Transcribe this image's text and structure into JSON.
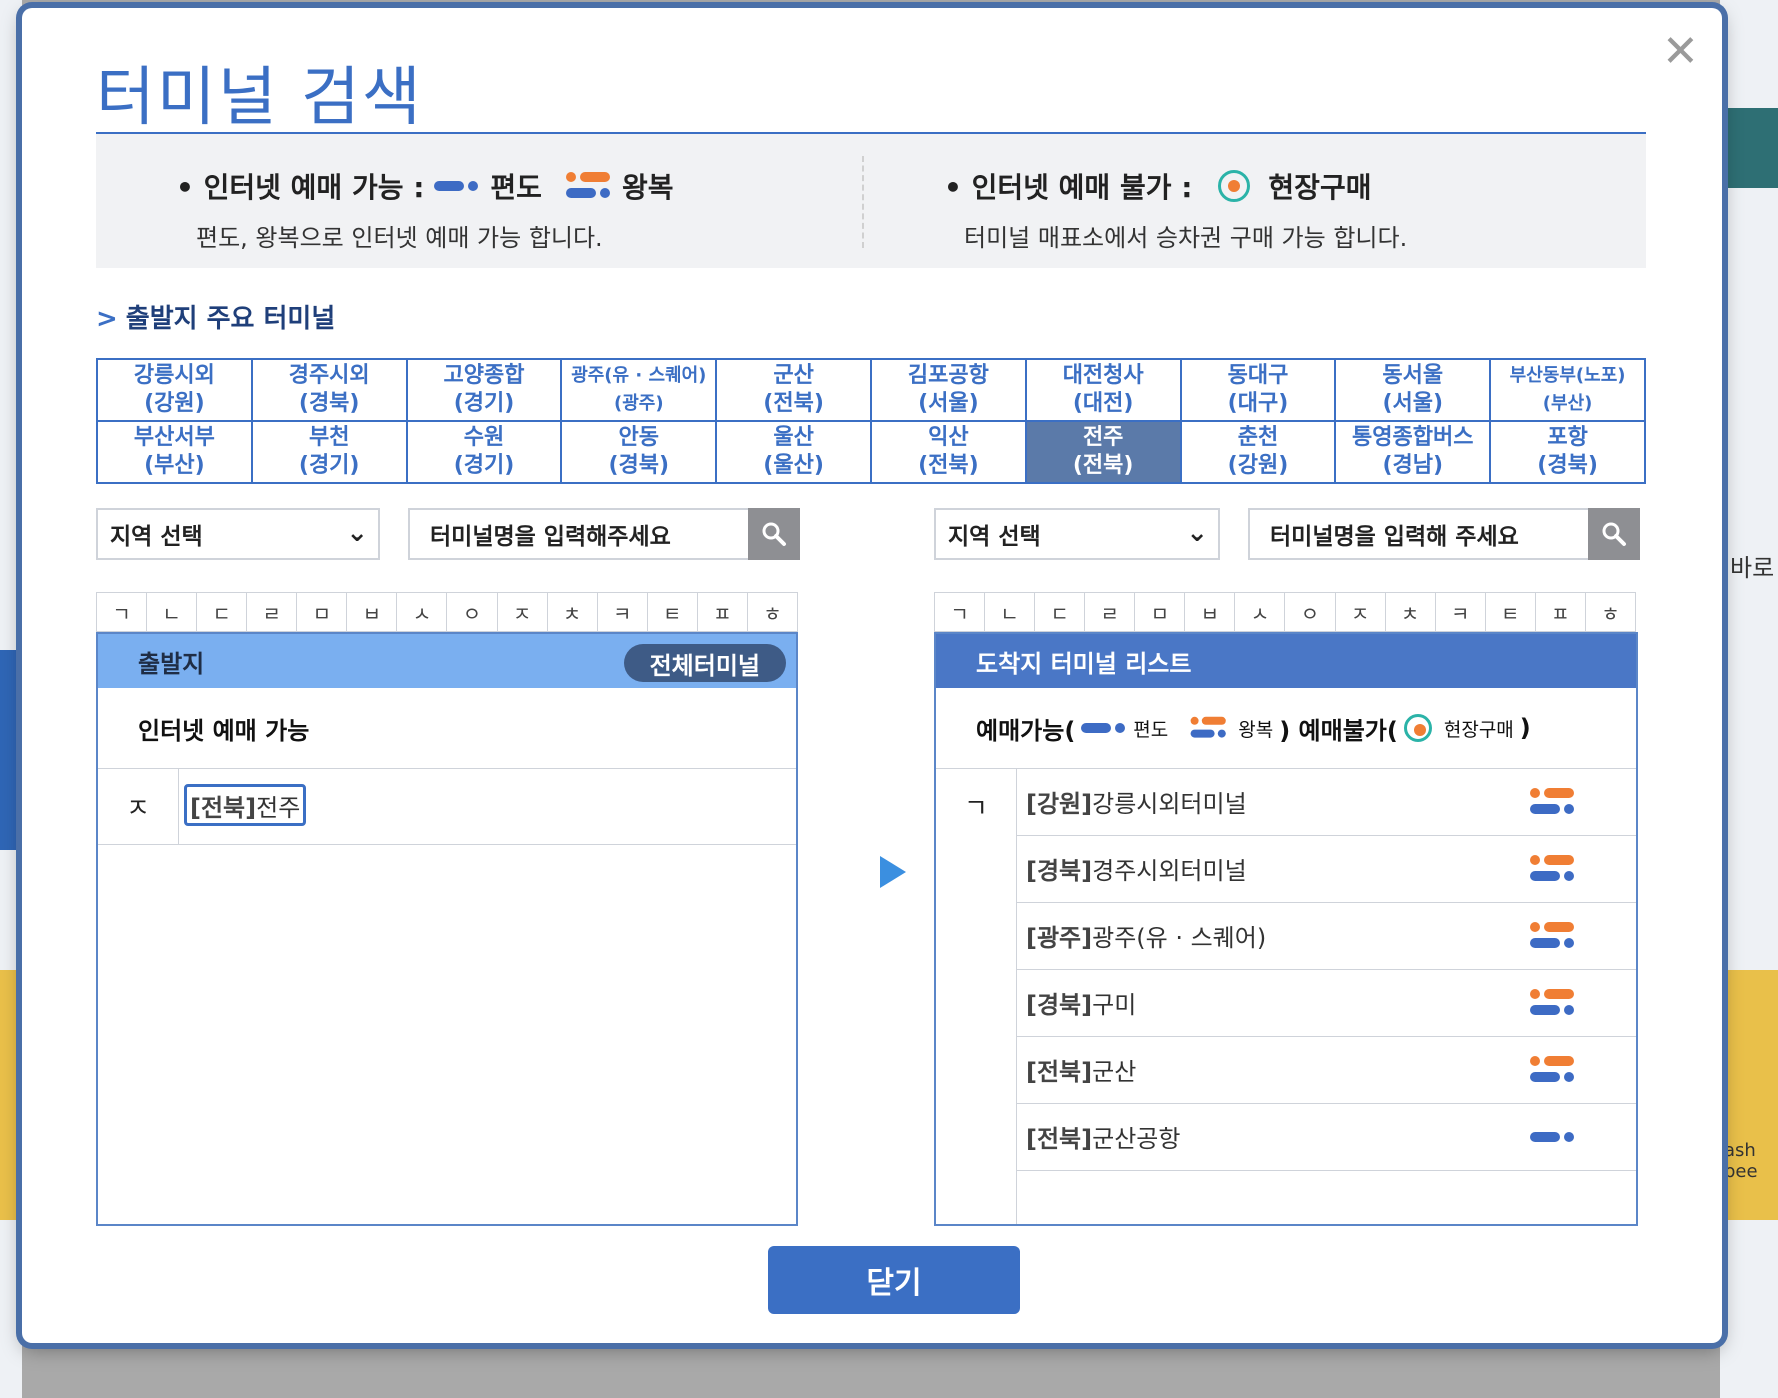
{
  "background": {
    "right_text_1": "바로",
    "right_text_2": "ash bee"
  },
  "modal": {
    "title": "터미널 검색",
    "close_glyph": "✕",
    "close_button": "닫기"
  },
  "legend": {
    "available_label": "• 인터넷 예매 가능 :",
    "oneway_label": "편도",
    "roundtrip_label": "왕복",
    "available_desc": "편도, 왕복으로 인터넷 예매 가능 합니다.",
    "unavailable_label": "• 인터넷 예매 불가 :",
    "onsite_label": "현장구매",
    "unavailable_desc": "터미널 매표소에서 승차권 구매 가능 합니다."
  },
  "major": {
    "title": "출발지 주요 터미널",
    "terminals": [
      {
        "name": "강릉시외",
        "region": "(강원)"
      },
      {
        "name": "경주시외",
        "region": "(경북)"
      },
      {
        "name": "고양종합",
        "region": "(경기)"
      },
      {
        "name": "광주(유 · 스퀘어)",
        "region": "(광주)"
      },
      {
        "name": "군산",
        "region": "(전북)"
      },
      {
        "name": "김포공항",
        "region": "(서울)"
      },
      {
        "name": "대전청사",
        "region": "(대전)"
      },
      {
        "name": "동대구",
        "region": "(대구)"
      },
      {
        "name": "동서울",
        "region": "(서울)"
      },
      {
        "name": "부산동부(노포)",
        "region": "(부산)"
      },
      {
        "name": "부산서부",
        "region": "(부산)"
      },
      {
        "name": "부천",
        "region": "(경기)"
      },
      {
        "name": "수원",
        "region": "(경기)"
      },
      {
        "name": "안동",
        "region": "(경북)"
      },
      {
        "name": "울산",
        "region": "(울산)"
      },
      {
        "name": "익산",
        "region": "(전북)"
      },
      {
        "name": "전주",
        "region": "(전북)"
      },
      {
        "name": "춘천",
        "region": "(강원)"
      },
      {
        "name": "통영종합버스",
        "region": "(경남)"
      },
      {
        "name": "포항",
        "region": "(경북)"
      }
    ]
  },
  "departure": {
    "region_select": "지역 선택",
    "search_placeholder": "터미널명을 입력해주세요",
    "header": "출발지",
    "all_button": "전체터미널",
    "sub_header": "인터넷 예매 가능",
    "group_initial": "ㅈ",
    "selected_region": "[전북]",
    "selected_name": "전주"
  },
  "arrival": {
    "region_select": "지역 선택",
    "search_placeholder": "터미널명을 입력해 주세요",
    "header": "도착지 터미널 리스트",
    "sub_prefix": "예매가능(",
    "sub_oneway": "편도",
    "sub_round": "왕복",
    "sub_mid": ") 예매불가(",
    "sub_onsite": "현장구매",
    "sub_suffix": ")",
    "group_initial": "ㄱ",
    "items": [
      {
        "region": "[강원]",
        "name": "강릉시외터미널",
        "type": "roundtrip"
      },
      {
        "region": "[경북]",
        "name": "경주시외터미널",
        "type": "roundtrip"
      },
      {
        "region": "[광주]",
        "name": "광주(유 · 스퀘어)",
        "type": "roundtrip"
      },
      {
        "region": "[경북]",
        "name": "구미",
        "type": "roundtrip"
      },
      {
        "region": "[전북]",
        "name": "군산",
        "type": "roundtrip"
      },
      {
        "region": "[전북]",
        "name": "군산공항",
        "type": "oneway"
      }
    ]
  },
  "jamo": [
    "ㄱ",
    "ㄴ",
    "ㄷ",
    "ㄹ",
    "ㅁ",
    "ㅂ",
    "ㅅ",
    "ㅇ",
    "ㅈ",
    "ㅊ",
    "ㅋ",
    "ㅌ",
    "ㅍ",
    "ㅎ"
  ],
  "colors": {
    "accent": "#3b6fc4",
    "depart_header": "#7aaff0",
    "arrive_header": "#4a77c6",
    "selected_cell": "#5b7aa9",
    "orange": "#f07e34",
    "teal": "#2bb3a8"
  }
}
